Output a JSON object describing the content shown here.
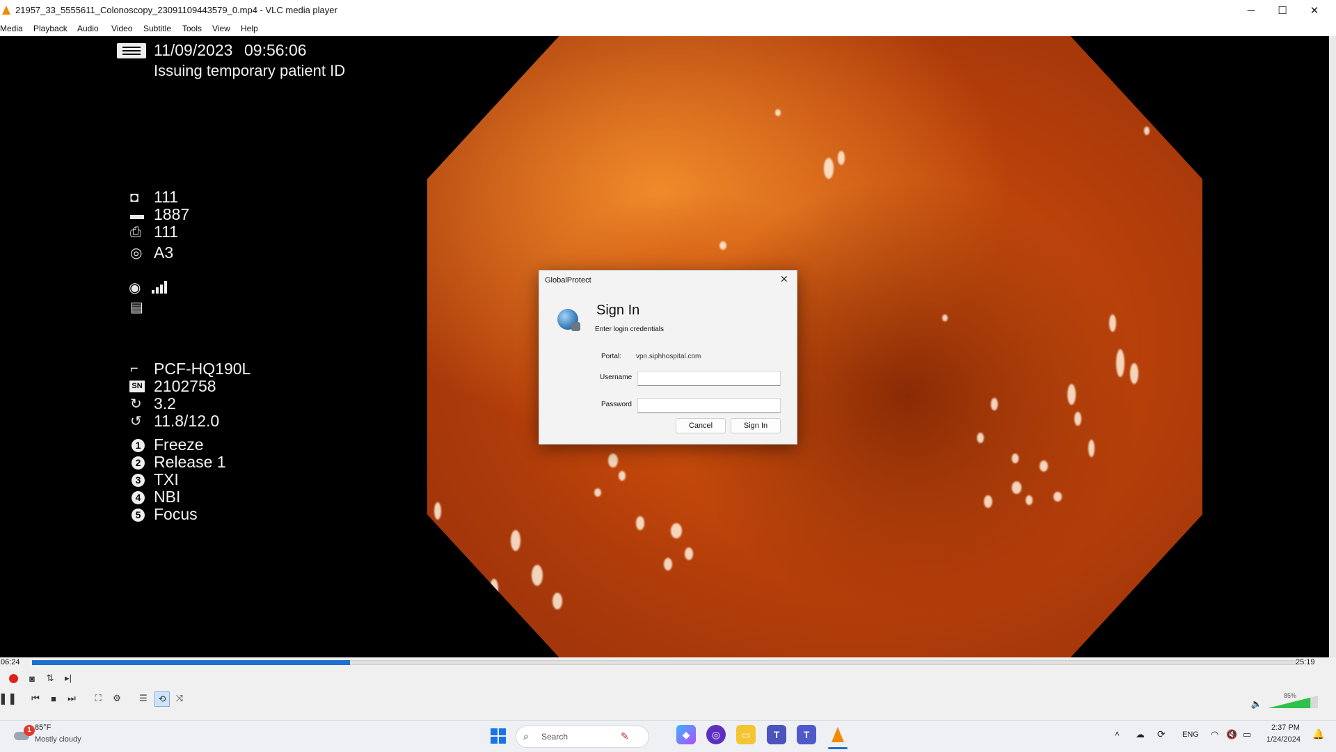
{
  "window": {
    "title": "21957_33_5555611_Colonoscopy_23091109443579_0.mp4 - VLC media player",
    "minimize": "─",
    "maximize": "☐",
    "close": "✕"
  },
  "menu": [
    "Media",
    "Playback",
    "Audio",
    "Video",
    "Subtitle",
    "Tools",
    "View",
    "Help"
  ],
  "overlay": {
    "date": "11/09/2023",
    "time": "09:56:06",
    "status": "Issuing temporary patient ID",
    "readouts": [
      {
        "icon": "camera-icon",
        "value": "111"
      },
      {
        "icon": "battery-icon",
        "value": "1887"
      },
      {
        "icon": "cvp-icon",
        "value": "111"
      },
      {
        "icon": "aperture-icon",
        "value": "A3"
      }
    ],
    "scope_model": "PCF-HQ190L",
    "serial_label": "SN",
    "serial": "2102758",
    "ratio_a": "3.2",
    "ratio_b": "11.8/12.0",
    "buttons": [
      {
        "num": "1",
        "label": "Freeze"
      },
      {
        "num": "2",
        "label": "Release 1"
      },
      {
        "num": "3",
        "label": "TXI"
      },
      {
        "num": "4",
        "label": "NBI"
      },
      {
        "num": "5",
        "label": "Focus"
      }
    ]
  },
  "dialog": {
    "title": "GlobalProtect",
    "heading": "Sign In",
    "subheading": "Enter login credentials",
    "portal_label": "Portal:",
    "portal_value": "vpn.siphhospital.com",
    "username_label": "Username",
    "password_label": "Password",
    "username_value": "",
    "password_value": "",
    "cancel": "Cancel",
    "sign_in": "Sign In"
  },
  "player": {
    "elapsed": "06:24",
    "total": "25:19",
    "progress": 0.252,
    "volume_label": "85%",
    "volume": 0.85
  },
  "taskbar": {
    "weather_badge": "1",
    "temp": "85°F",
    "weather": "Mostly cloudy",
    "search_placeholder": "Search",
    "lang": "ENG",
    "clock_time": "2:37 PM",
    "clock_date": "1/24/2024"
  },
  "colors": {
    "accent": "#1e6fd0",
    "record": "#e0201c",
    "vlc_orange": "#f28a00"
  }
}
